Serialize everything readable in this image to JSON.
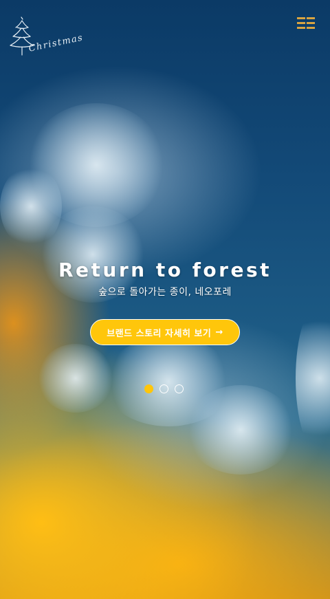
{
  "brand": {
    "logo_text": "Christmas",
    "logo_icon": "christmas-tree-icon"
  },
  "header": {
    "menu_icon": "hamburger-menu-icon"
  },
  "hero": {
    "headline": "Return to forest",
    "subline": "숲으로 돌아가는 종이, 네오포레",
    "cta_label": "브랜드 스토리 자세히 보기",
    "cta_arrow": "→"
  },
  "slider": {
    "count": 3,
    "active_index": 0
  },
  "colors": {
    "accent": "#ffc60b",
    "menu_icon": "#d9a441",
    "text": "#ffffff"
  }
}
